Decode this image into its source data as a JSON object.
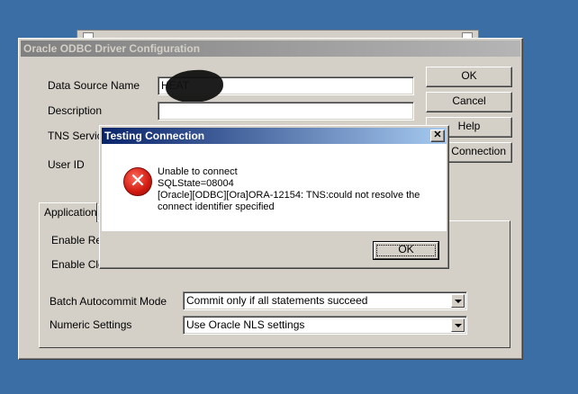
{
  "main_dialog": {
    "title": "Oracle ODBC Driver Configuration",
    "labels": {
      "data_source_name": "Data Source Name",
      "description": "Description",
      "tns_service": "TNS Servic",
      "user_id": "User ID"
    },
    "fields": {
      "data_source_name_value": "HEAT",
      "description_value": ""
    },
    "buttons": {
      "ok": "OK",
      "cancel": "Cancel",
      "help": "Help",
      "test_connection": "st Connection"
    },
    "tabs": {
      "application": "Application"
    },
    "application_tab": {
      "enable_res": "Enable Res",
      "enable_clo": "Enable Clo",
      "batch_autocommit_label": "Batch Autocommit Mode",
      "batch_autocommit_value": "Commit only if all statements succeed",
      "numeric_settings_label": "Numeric Settings",
      "numeric_settings_value": "Use Oracle NLS settings"
    }
  },
  "test_dialog": {
    "title": "Testing Connection",
    "close_glyph": "✕",
    "icon": "error-icon",
    "icon_glyph": "✕",
    "message_lines": [
      "Unable to connect",
      "SQLState=08004",
      "[Oracle][ODBC][Ora]ORA-12154: TNS:could not resolve the",
      "connect identifier specified"
    ],
    "ok_label": "OK"
  },
  "colors": {
    "desktop": "#3a6ea5",
    "active_title": "#0a246a",
    "inactive_title": "#808080",
    "error_red": "#d01a10"
  }
}
